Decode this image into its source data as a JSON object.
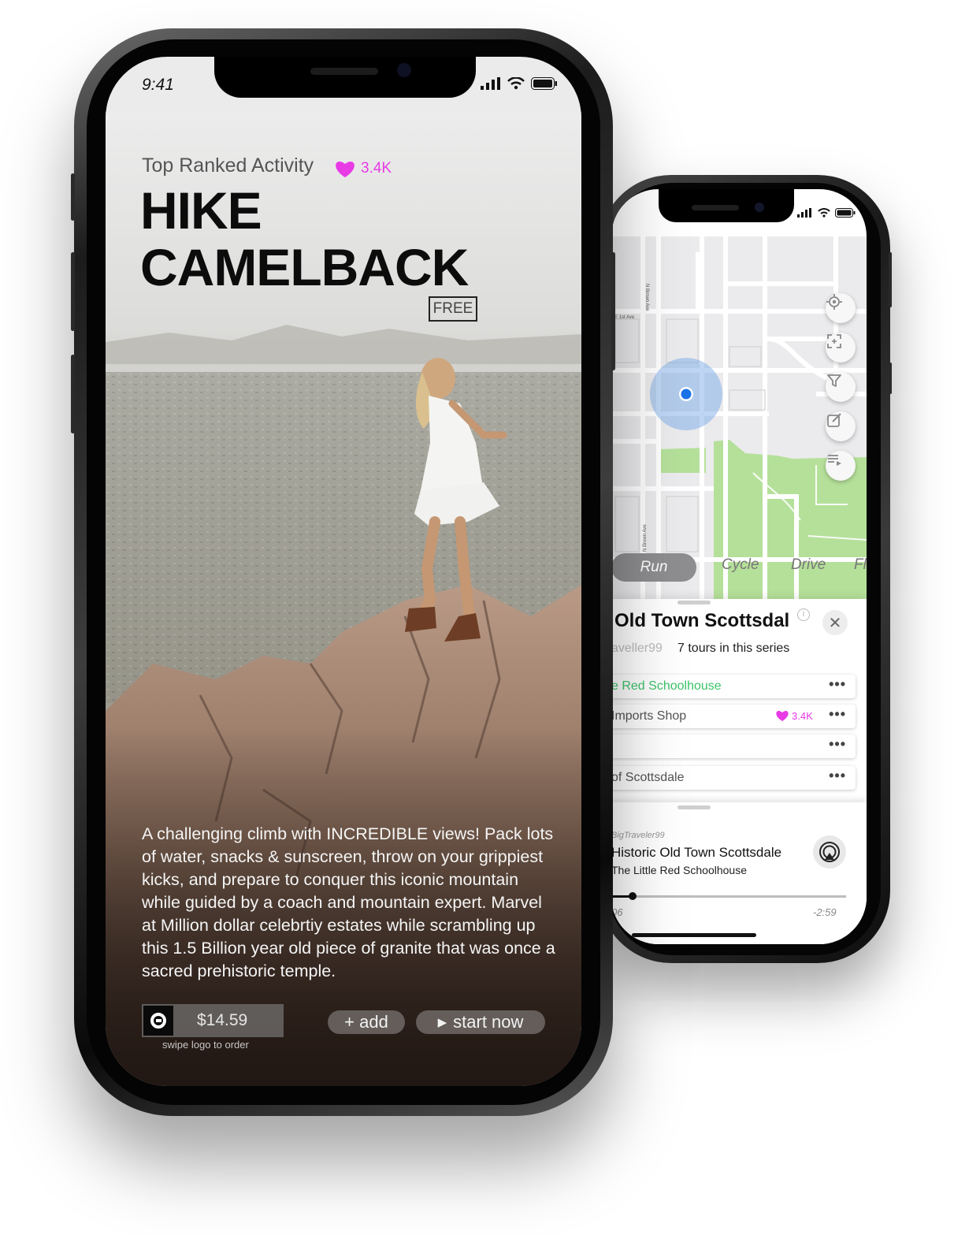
{
  "front_phone": {
    "status_time": "9:41",
    "category": "Top Ranked Activity",
    "likes": "3.4K",
    "title_line1": "HIKE",
    "title_line2": "CAMELBACK",
    "price_tag": "FREE",
    "description": "A challenging climb with INCREDIBLE views! Pack lots of water, snacks & sunscreen, throw on your grippiest kicks, and prepare to conquer this iconic mountain while guided by a coach and mountain expert. Marvel at Million dollar celebrtiy estates while scrambling up this 1.5 Billion year old piece of granite that was once a sacred prehistoric temple.",
    "order": {
      "price": "$14.59",
      "hint": "swipe logo to order"
    },
    "add_label": "+ add",
    "start_label": "start now",
    "like_color": "#e83be6"
  },
  "back_phone": {
    "map": {
      "street_labels": [
        "N Brown Ave",
        "E 1st Ave",
        "N Brown Ave"
      ],
      "park_color": "#b5e09a",
      "location_color": "#1a73e8",
      "buttons": [
        "locate-icon",
        "focus-icon",
        "filter-icon",
        "edit-icon",
        "playlist-icon"
      ]
    },
    "modes": [
      "Run",
      "Cycle",
      "Drive",
      "Fl"
    ],
    "tour": {
      "title": "Old Town Scottsdal",
      "author": "aveller99",
      "series": "7 tours in this series"
    },
    "stops": [
      {
        "label": "e Red Schoolhouse",
        "likes": ""
      },
      {
        "label": "Imports Shop",
        "likes": "3.4K"
      },
      {
        "label": "",
        "likes": ""
      },
      {
        "label": "of Scottsdale",
        "likes": ""
      }
    ],
    "player": {
      "author": "BigTraveler99",
      "title": "Historic Old Town Scottsdale",
      "subtitle": "The Little Red Schoolhouse",
      "elapsed": "06",
      "remaining": "-2:59",
      "progress": 0.09
    },
    "active_stop_color": "#3cc46a"
  }
}
